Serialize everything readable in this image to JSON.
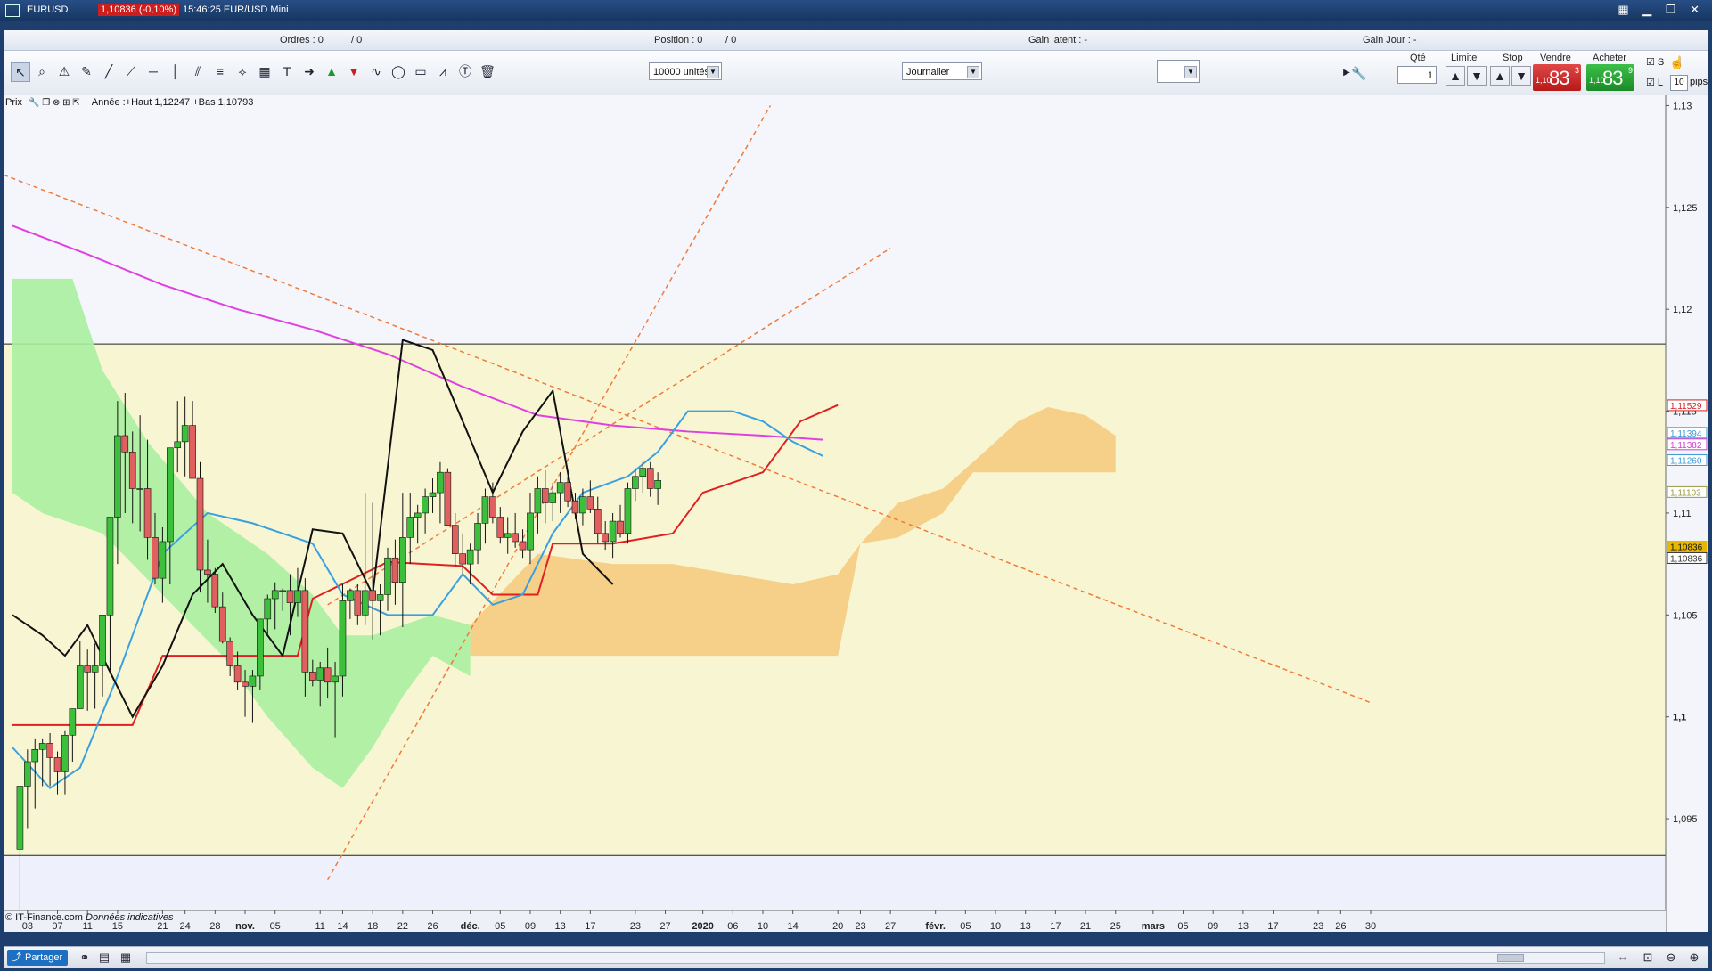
{
  "window": {
    "symbol": "EURUSD",
    "price_badge": "1,10836 (-0,10%)",
    "clock": "15:46:25 EUR/USD Mini"
  },
  "infobar": {
    "orders": "Ordres : 0",
    "orders_b": "/ 0",
    "position": "Position : 0",
    "position_b": "/ 0",
    "gain_latent": "Gain latent : -",
    "gain_jour": "Gain Jour : -"
  },
  "toolbar": {
    "units": "10000 unités",
    "period": "Journalier"
  },
  "order_panel": {
    "qty_label": "Qté",
    "qty_value": "1",
    "limit_label": "Limite",
    "stop_label": "Stop",
    "sell_label": "Vendre",
    "buy_label": "Acheter",
    "sell_small": "1,10",
    "sell_big": "83",
    "sell_sup": "3",
    "buy_small": "1,10",
    "buy_big": "83",
    "buy_sup": "9",
    "s_label": "S",
    "l_label": "L",
    "pips_value": "10",
    "pips_label": "pips"
  },
  "chart_header": {
    "prix": "Prix",
    "annee": "Année :+Haut 1,12247 +Bas 1,10793"
  },
  "footer": {
    "copyright": "© IT-Finance.com",
    "disclaimer": "Données indicatives",
    "share": "Partager"
  },
  "chart_data": {
    "type": "candlestick",
    "ylim": [
      1.0905,
      1.1305
    ],
    "yticks": [
      {
        "v": 1.13,
        "label": "1,13",
        "bold": false
      },
      {
        "v": 1.125,
        "label": "1,125",
        "bold": false
      },
      {
        "v": 1.12,
        "label": "1,12",
        "bold": false
      },
      {
        "v": 1.115,
        "label": "1,115",
        "bold": false
      },
      {
        "v": 1.11,
        "label": "1,11",
        "bold": false
      },
      {
        "v": 1.105,
        "label": "1,105",
        "bold": false
      },
      {
        "v": 1.1,
        "label": "1,1",
        "bold": true
      },
      {
        "v": 1.095,
        "label": "1,095",
        "bold": false
      }
    ],
    "xticks": [
      {
        "d": 2,
        "label": "03"
      },
      {
        "d": 6,
        "label": "07"
      },
      {
        "d": 10,
        "label": "11"
      },
      {
        "d": 14,
        "label": "15"
      },
      {
        "d": 20,
        "label": "21"
      },
      {
        "d": 23,
        "label": "24"
      },
      {
        "d": 27,
        "label": "28"
      },
      {
        "d": 31,
        "label": "nov.",
        "bold": true
      },
      {
        "d": 35,
        "label": "05"
      },
      {
        "d": 41,
        "label": "11"
      },
      {
        "d": 44,
        "label": "14"
      },
      {
        "d": 48,
        "label": "18"
      },
      {
        "d": 52,
        "label": "22"
      },
      {
        "d": 56,
        "label": "26"
      },
      {
        "d": 61,
        "label": "déc.",
        "bold": true
      },
      {
        "d": 65,
        "label": "05"
      },
      {
        "d": 69,
        "label": "09"
      },
      {
        "d": 73,
        "label": "13"
      },
      {
        "d": 77,
        "label": "17"
      },
      {
        "d": 83,
        "label": "23"
      },
      {
        "d": 87,
        "label": "27"
      },
      {
        "d": 92,
        "label": "2020",
        "bold": true
      },
      {
        "d": 96,
        "label": "06"
      },
      {
        "d": 100,
        "label": "10"
      },
      {
        "d": 104,
        "label": "14"
      },
      {
        "d": 110,
        "label": "20"
      },
      {
        "d": 113,
        "label": "23"
      },
      {
        "d": 117,
        "label": "27"
      },
      {
        "d": 123,
        "label": "févr.",
        "bold": true
      },
      {
        "d": 127,
        "label": "05"
      },
      {
        "d": 131,
        "label": "10"
      },
      {
        "d": 135,
        "label": "13"
      },
      {
        "d": 139,
        "label": "17"
      },
      {
        "d": 143,
        "label": "21"
      },
      {
        "d": 147,
        "label": "25"
      },
      {
        "d": 152,
        "label": "mars",
        "bold": true
      },
      {
        "d": 156,
        "label": "05"
      },
      {
        "d": 160,
        "label": "09"
      },
      {
        "d": 164,
        "label": "13"
      },
      {
        "d": 168,
        "label": "17"
      },
      {
        "d": 174,
        "label": "23"
      },
      {
        "d": 177,
        "label": "26"
      },
      {
        "d": 181,
        "label": "30"
      }
    ],
    "candles": [
      {
        "x": 1,
        "o": 1.0935,
        "h": 1.0966,
        "l": 1.0905,
        "c": 1.0966
      },
      {
        "x": 2,
        "o": 1.0966,
        "h": 1.0984,
        "l": 1.0945,
        "c": 1.0978
      },
      {
        "x": 3,
        "o": 1.0978,
        "h": 1.0989,
        "l": 1.0955,
        "c": 1.0984
      },
      {
        "x": 4,
        "o": 1.0984,
        "h": 1.0989,
        "l": 1.0966,
        "c": 1.0987
      },
      {
        "x": 5,
        "o": 1.0987,
        "h": 1.0992,
        "l": 1.0966,
        "c": 1.098
      },
      {
        "x": 6,
        "o": 1.098,
        "h": 1.0983,
        "l": 1.0962,
        "c": 1.0973
      },
      {
        "x": 7,
        "o": 1.0973,
        "h": 1.0993,
        "l": 1.0962,
        "c": 1.0991
      },
      {
        "x": 8,
        "o": 1.0991,
        "h": 1.1004,
        "l": 1.0978,
        "c": 1.1004
      },
      {
        "x": 9,
        "o": 1.1004,
        "h": 1.1037,
        "l": 1.1004,
        "c": 1.1025
      },
      {
        "x": 10,
        "o": 1.1025,
        "h": 1.1033,
        "l": 1.1003,
        "c": 1.1022
      },
      {
        "x": 11,
        "o": 1.1022,
        "h": 1.1036,
        "l": 1.1004,
        "c": 1.1025
      },
      {
        "x": 12,
        "o": 1.1025,
        "h": 1.1046,
        "l": 1.101,
        "c": 1.105
      },
      {
        "x": 13,
        "o": 1.105,
        "h": 1.1082,
        "l": 1.1021,
        "c": 1.1098
      },
      {
        "x": 14,
        "o": 1.1098,
        "h": 1.1155,
        "l": 1.1075,
        "c": 1.1138
      },
      {
        "x": 15,
        "o": 1.1138,
        "h": 1.1159,
        "l": 1.11,
        "c": 1.113
      },
      {
        "x": 16,
        "o": 1.113,
        "h": 1.114,
        "l": 1.1095,
        "c": 1.1112
      },
      {
        "x": 17,
        "o": 1.1112,
        "h": 1.1148,
        "l": 1.1091,
        "c": 1.1112
      },
      {
        "x": 18,
        "o": 1.1112,
        "h": 1.1136,
        "l": 1.1077,
        "c": 1.1088
      },
      {
        "x": 19,
        "o": 1.1088,
        "h": 1.11,
        "l": 1.1065,
        "c": 1.1068
      },
      {
        "x": 20,
        "o": 1.1068,
        "h": 1.1093,
        "l": 1.1056,
        "c": 1.1086
      },
      {
        "x": 21,
        "o": 1.1086,
        "h": 1.11,
        "l": 1.1065,
        "c": 1.1132
      },
      {
        "x": 22,
        "o": 1.1132,
        "h": 1.1155,
        "l": 1.112,
        "c": 1.1135
      },
      {
        "x": 23,
        "o": 1.1135,
        "h": 1.1157,
        "l": 1.1118,
        "c": 1.1143
      },
      {
        "x": 24,
        "o": 1.1143,
        "h": 1.1155,
        "l": 1.1117,
        "c": 1.1117
      },
      {
        "x": 25,
        "o": 1.1117,
        "h": 1.1125,
        "l": 1.1061,
        "c": 1.1072
      },
      {
        "x": 26,
        "o": 1.1072,
        "h": 1.1087,
        "l": 1.1056,
        "c": 1.107
      },
      {
        "x": 27,
        "o": 1.107,
        "h": 1.1073,
        "l": 1.1051,
        "c": 1.1054
      },
      {
        "x": 28,
        "o": 1.1054,
        "h": 1.1061,
        "l": 1.1036,
        "c": 1.1037
      },
      {
        "x": 29,
        "o": 1.1037,
        "h": 1.1039,
        "l": 1.102,
        "c": 1.1025
      },
      {
        "x": 30,
        "o": 1.1025,
        "h": 1.1032,
        "l": 1.1013,
        "c": 1.1017
      },
      {
        "x": 31,
        "o": 1.1017,
        "h": 1.1023,
        "l": 1.1,
        "c": 1.1015
      },
      {
        "x": 32,
        "o": 1.1015,
        "h": 1.1023,
        "l": 1.0997,
        "c": 1.102
      },
      {
        "x": 33,
        "o": 1.102,
        "h": 1.1048,
        "l": 1.1013,
        "c": 1.1048
      },
      {
        "x": 34,
        "o": 1.1048,
        "h": 1.106,
        "l": 1.104,
        "c": 1.1058
      },
      {
        "x": 35,
        "o": 1.1058,
        "h": 1.1066,
        "l": 1.1043,
        "c": 1.1062
      },
      {
        "x": 36,
        "o": 1.1062,
        "h": 1.1063,
        "l": 1.1052,
        "c": 1.1062
      },
      {
        "x": 37,
        "o": 1.1062,
        "h": 1.107,
        "l": 1.104,
        "c": 1.1056
      },
      {
        "x": 38,
        "o": 1.1056,
        "h": 1.1073,
        "l": 1.1049,
        "c": 1.1062
      },
      {
        "x": 39,
        "o": 1.1062,
        "h": 1.1068,
        "l": 1.101,
        "c": 1.1022
      },
      {
        "x": 40,
        "o": 1.1022,
        "h": 1.1028,
        "l": 1.1015,
        "c": 1.1018
      },
      {
        "x": 41,
        "o": 1.1018,
        "h": 1.1027,
        "l": 1.1005,
        "c": 1.1024
      },
      {
        "x": 42,
        "o": 1.1024,
        "h": 1.1034,
        "l": 1.1009,
        "c": 1.1017
      },
      {
        "x": 43,
        "o": 1.1017,
        "h": 1.1027,
        "l": 1.099,
        "c": 1.102
      },
      {
        "x": 44,
        "o": 1.102,
        "h": 1.1065,
        "l": 1.101,
        "c": 1.1057
      },
      {
        "x": 45,
        "o": 1.1057,
        "h": 1.1063,
        "l": 1.1048,
        "c": 1.1062
      },
      {
        "x": 46,
        "o": 1.1062,
        "h": 1.1065,
        "l": 1.1045,
        "c": 1.105
      },
      {
        "x": 47,
        "o": 1.105,
        "h": 1.111,
        "l": 1.1045,
        "c": 1.1062
      },
      {
        "x": 48,
        "o": 1.1062,
        "h": 1.1105,
        "l": 1.1038,
        "c": 1.1057
      },
      {
        "x": 49,
        "o": 1.1057,
        "h": 1.1065,
        "l": 1.104,
        "c": 1.106
      },
      {
        "x": 50,
        "o": 1.106,
        "h": 1.1083,
        "l": 1.1052,
        "c": 1.1078
      },
      {
        "x": 51,
        "o": 1.1078,
        "h": 1.1087,
        "l": 1.1055,
        "c": 1.1066
      },
      {
        "x": 52,
        "o": 1.1066,
        "h": 1.111,
        "l": 1.1044,
        "c": 1.1088
      },
      {
        "x": 53,
        "o": 1.1088,
        "h": 1.111,
        "l": 1.1075,
        "c": 1.1098
      },
      {
        "x": 54,
        "o": 1.1098,
        "h": 1.1104,
        "l": 1.1085,
        "c": 1.11
      },
      {
        "x": 55,
        "o": 1.11,
        "h": 1.1112,
        "l": 1.109,
        "c": 1.1108
      },
      {
        "x": 56,
        "o": 1.1108,
        "h": 1.1117,
        "l": 1.11,
        "c": 1.111
      },
      {
        "x": 57,
        "o": 1.111,
        "h": 1.1125,
        "l": 1.1095,
        "c": 1.112
      },
      {
        "x": 58,
        "o": 1.112,
        "h": 1.1122,
        "l": 1.1095,
        "c": 1.1094
      },
      {
        "x": 59,
        "o": 1.1094,
        "h": 1.11,
        "l": 1.1074,
        "c": 1.108
      },
      {
        "x": 60,
        "o": 1.108,
        "h": 1.109,
        "l": 1.107,
        "c": 1.1075
      },
      {
        "x": 61,
        "o": 1.1075,
        "h": 1.1085,
        "l": 1.1065,
        "c": 1.1082
      },
      {
        "x": 62,
        "o": 1.1082,
        "h": 1.11,
        "l": 1.1075,
        "c": 1.1095
      },
      {
        "x": 63,
        "o": 1.1095,
        "h": 1.1112,
        "l": 1.1085,
        "c": 1.1108
      },
      {
        "x": 64,
        "o": 1.1108,
        "h": 1.1115,
        "l": 1.1095,
        "c": 1.1098
      },
      {
        "x": 65,
        "o": 1.1098,
        "h": 1.1103,
        "l": 1.1085,
        "c": 1.1088
      },
      {
        "x": 66,
        "o": 1.1088,
        "h": 1.1098,
        "l": 1.108,
        "c": 1.109
      },
      {
        "x": 67,
        "o": 1.109,
        "h": 1.11,
        "l": 1.1083,
        "c": 1.1086
      },
      {
        "x": 68,
        "o": 1.1086,
        "h": 1.1092,
        "l": 1.1078,
        "c": 1.1082
      },
      {
        "x": 69,
        "o": 1.1082,
        "h": 1.111,
        "l": 1.1075,
        "c": 1.11
      },
      {
        "x": 70,
        "o": 1.11,
        "h": 1.1118,
        "l": 1.109,
        "c": 1.1112
      },
      {
        "x": 71,
        "o": 1.1112,
        "h": 1.1121,
        "l": 1.1095,
        "c": 1.1105
      },
      {
        "x": 72,
        "o": 1.1105,
        "h": 1.1115,
        "l": 1.1096,
        "c": 1.111
      },
      {
        "x": 73,
        "o": 1.111,
        "h": 1.112,
        "l": 1.11,
        "c": 1.1115
      },
      {
        "x": 74,
        "o": 1.1115,
        "h": 1.1118,
        "l": 1.1103,
        "c": 1.1106
      },
      {
        "x": 75,
        "o": 1.1106,
        "h": 1.111,
        "l": 1.1097,
        "c": 1.11
      },
      {
        "x": 76,
        "o": 1.11,
        "h": 1.1112,
        "l": 1.1094,
        "c": 1.1108
      },
      {
        "x": 77,
        "o": 1.1108,
        "h": 1.1116,
        "l": 1.11,
        "c": 1.1102
      },
      {
        "x": 78,
        "o": 1.1102,
        "h": 1.1108,
        "l": 1.1085,
        "c": 1.109
      },
      {
        "x": 79,
        "o": 1.109,
        "h": 1.1096,
        "l": 1.1082,
        "c": 1.1086
      },
      {
        "x": 80,
        "o": 1.1086,
        "h": 1.11,
        "l": 1.1078,
        "c": 1.1096
      },
      {
        "x": 81,
        "o": 1.1096,
        "h": 1.1104,
        "l": 1.1088,
        "c": 1.109
      },
      {
        "x": 82,
        "o": 1.109,
        "h": 1.1115,
        "l": 1.1085,
        "c": 1.1112
      },
      {
        "x": 83,
        "o": 1.1112,
        "h": 1.1122,
        "l": 1.1106,
        "c": 1.1118
      },
      {
        "x": 84,
        "o": 1.1118,
        "h": 1.1125,
        "l": 1.111,
        "c": 1.1122
      },
      {
        "x": 85,
        "o": 1.1122,
        "h": 1.1125,
        "l": 1.1108,
        "c": 1.1112
      },
      {
        "x": 86,
        "o": 1.1112,
        "h": 1.112,
        "l": 1.1104,
        "c": 1.1116
      }
    ]
  },
  "price_tags": [
    {
      "label": "1,11529",
      "v": 1.11529,
      "color": "#d42020"
    },
    {
      "label": "1,11394",
      "v": 1.11394,
      "color": "#3a9ad8"
    },
    {
      "label": "1,11382",
      "v": 1.11382,
      "color": "#d43cd4"
    },
    {
      "label": "1,11260",
      "v": 1.1126,
      "color": "#3a9ad8"
    },
    {
      "label": "1,11103",
      "v": 1.11103,
      "color": "#9a9a40"
    },
    {
      "label": "1,10836",
      "v": 1.10836,
      "color": "#e8b800"
    },
    {
      "label": "1,10836",
      "v": 1.10836,
      "color": "#333333"
    }
  ]
}
